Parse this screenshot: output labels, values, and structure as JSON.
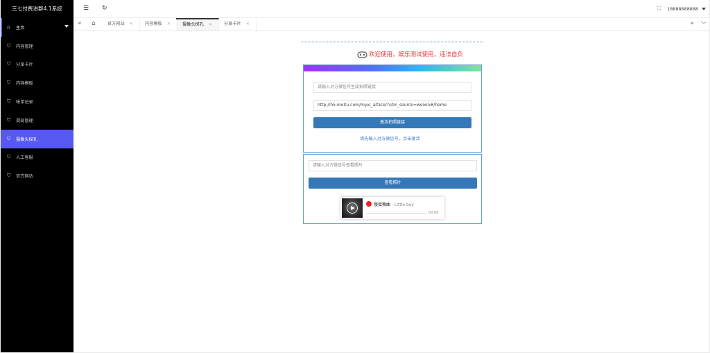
{
  "app": {
    "title": "三七付费进群4.1系统"
  },
  "header": {
    "user": "18888888888"
  },
  "sidebar": {
    "items": [
      {
        "label": "主页"
      },
      {
        "label": "内容管理"
      },
      {
        "label": "分享卡片"
      },
      {
        "label": "内容模板"
      },
      {
        "label": "帐单记录"
      },
      {
        "label": "提现管理"
      },
      {
        "label": "摄像头探孔"
      },
      {
        "label": "人工客服"
      },
      {
        "label": "官方网站"
      }
    ],
    "active_index": 6
  },
  "tabs": [
    {
      "label": "官方网站"
    },
    {
      "label": "内容模板"
    },
    {
      "label": "摄像头探孔"
    },
    {
      "label": "分享卡片"
    }
  ],
  "main": {
    "welcome": "欢迎使用，娱乐测试使用，违法自负",
    "card1": {
      "input1_placeholder": "请输入对方微信号生成拍照链接",
      "input2_value": "http://h5.meitu.com/myxj_aiface/?utm_source=weixin#/home",
      "button": "激活拍照链接",
      "hint": "请先输入对方微信号，点击激活"
    },
    "card2": {
      "input_placeholder": "请输入对方微信号查看照片",
      "button": "查看照片"
    },
    "player": {
      "title": "慢摇舞曲",
      "artist": "- Little boy",
      "time": "00:00"
    }
  },
  "colors": {
    "sidebar_bg": "#000000",
    "active_nav": "#5757f2",
    "button": "#3478b8",
    "welcome_text": "#e8323a",
    "card_border": "#6a9bd6"
  }
}
